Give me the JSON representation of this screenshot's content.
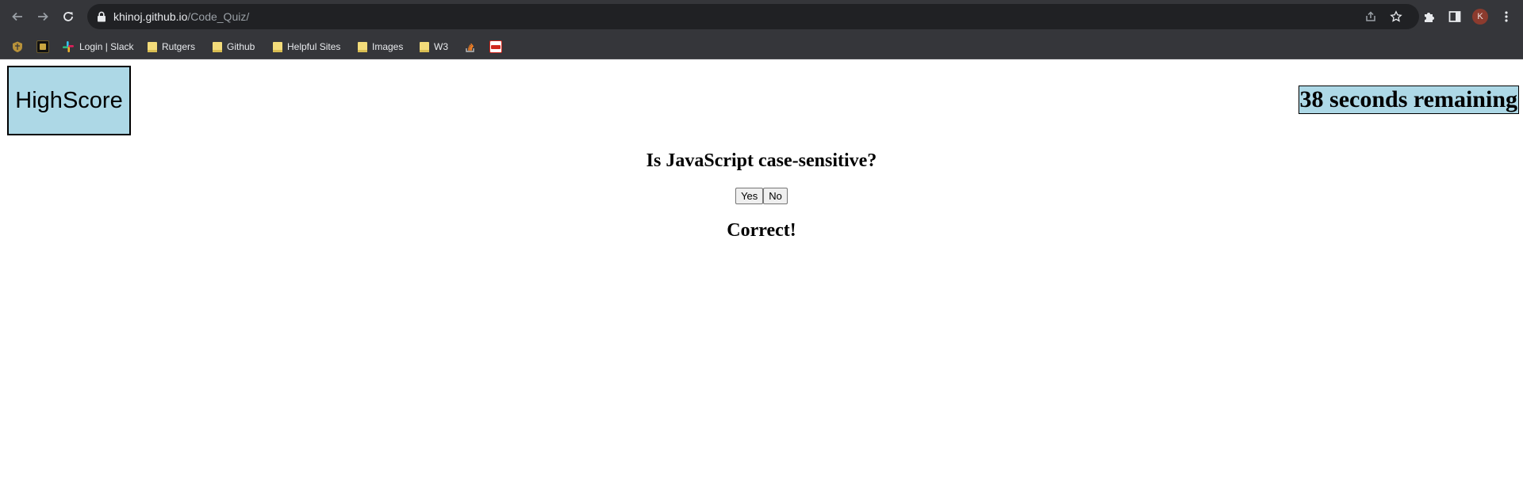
{
  "browser": {
    "url_host": "khinoj.github.io",
    "url_path": "/Code_Quiz/",
    "profile_initial": "K",
    "icons": {
      "back": "arrow-left-icon",
      "forward": "arrow-right-icon",
      "reload": "reload-icon",
      "lock": "lock-icon",
      "share": "share-icon",
      "bookmark": "star-icon",
      "extensions": "puzzle-icon",
      "side_panel": "side-panel-icon",
      "menu": "kebab-menu-icon"
    }
  },
  "bookmarks": [
    {
      "label": "",
      "icon": "shield-favicon"
    },
    {
      "label": "",
      "icon": "crest-favicon"
    },
    {
      "label": "Login | Slack",
      "icon": "slack-icon"
    },
    {
      "label": "Rutgers",
      "icon": "folder-icon"
    },
    {
      "label": "Github",
      "icon": "folder-icon"
    },
    {
      "label": "Helpful Sites",
      "icon": "folder-icon"
    },
    {
      "label": "Images",
      "icon": "folder-icon"
    },
    {
      "label": "W3",
      "icon": "folder-icon"
    },
    {
      "label": "",
      "icon": "stack-overflow-icon"
    },
    {
      "label": "",
      "icon": "adp-icon"
    }
  ],
  "quiz": {
    "highscore_label": "HighScore",
    "timer_text": "38 seconds remaining",
    "question": "Is JavaScript case-sensitive?",
    "answers": [
      "Yes",
      "No"
    ],
    "feedback": "Correct!"
  },
  "colors": {
    "chrome_bg": "#35363a",
    "omnibox_bg": "#202124",
    "panel_bg": "#add8e6"
  }
}
